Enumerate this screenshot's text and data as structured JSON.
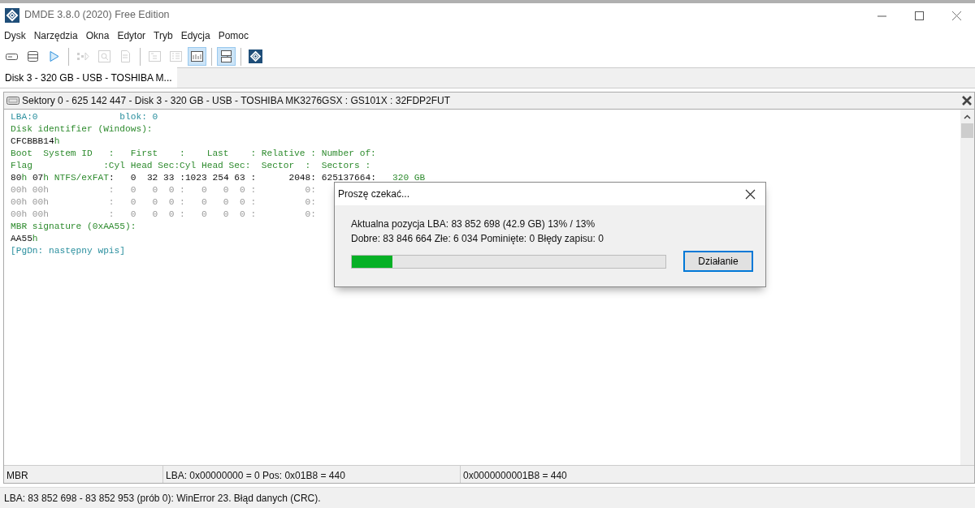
{
  "window": {
    "title": "DMDE 3.8.0 (2020) Free Edition"
  },
  "menu": [
    "Dysk",
    "Narzędzia",
    "Okna",
    "Edytor",
    "Tryb",
    "Edycja",
    "Pomoc"
  ],
  "toolbar": [
    {
      "disabled": false,
      "pressed": false
    },
    {
      "disabled": false,
      "pressed": false
    },
    {
      "disabled": false,
      "pressed": false
    },
    {
      "disabled": true,
      "pressed": false
    },
    {
      "disabled": true,
      "pressed": false
    },
    {
      "disabled": true,
      "pressed": false
    },
    {
      "disabled": true,
      "pressed": false
    },
    {
      "disabled": true,
      "pressed": false
    },
    {
      "disabled": false,
      "pressed": true
    },
    {
      "disabled": false,
      "pressed": true
    },
    {
      "disabled": false,
      "pressed": false
    }
  ],
  "tabs": [
    {
      "label": "Disk 3 - 320 GB - USB - TOSHIBA M...",
      "selected": true
    }
  ],
  "panel": {
    "title": "Sektory 0 - 625 142 447 - Disk 3 - 320 GB - USB - TOSHIBA MK3276GSX : GS101X : 32FDP2FUT",
    "lines": [
      [
        {
          "text": "LBA:0               blok: 0",
          "kind": "link"
        }
      ],
      [
        {
          "text": "Disk identifier (Windows):",
          "kind": "label"
        }
      ],
      [
        {
          "text": "CFCBBB14",
          "kind": "value"
        },
        {
          "text": "h",
          "kind": "label"
        }
      ],
      [
        {
          "text": "Boot  System ID   :   First    :    Last    : Relative : Number of:",
          "kind": "label"
        }
      ],
      [
        {
          "text": "Flag             :Cyl Head Sec:Cyl Head Sec:  Sector  :  Sectors :",
          "kind": "label"
        }
      ],
      [
        {
          "text": "80",
          "kind": "value"
        },
        {
          "text": "h ",
          "kind": "label"
        },
        {
          "text": "07",
          "kind": "value"
        },
        {
          "text": "h NTFS/exFAT",
          "kind": "label"
        },
        {
          "text": ":   0  32 33 :1023 254 63 :      2048: 625137664:",
          "kind": "value"
        },
        {
          "text": "   320 GB",
          "kind": "label"
        }
      ],
      [
        {
          "text": "00h 00h           :   0   0  0 :   0   0  0 :         0:",
          "kind": "zero"
        }
      ],
      [
        {
          "text": "00h 00h           :   0   0  0 :   0   0  0 :         0:",
          "kind": "zero"
        }
      ],
      [
        {
          "text": "00h 00h           :   0   0  0 :   0   0  0 :         0:",
          "kind": "zero"
        }
      ],
      [
        {
          "text": "MBR signature (0xAA55):",
          "kind": "label"
        }
      ],
      [
        {
          "text": "AA55",
          "kind": "value"
        },
        {
          "text": "h",
          "kind": "label"
        }
      ],
      [
        {
          "text": "[PgDn: następny wpis]",
          "kind": "link"
        }
      ]
    ],
    "status": [
      "MBR",
      "LBA: 0x00000000 = 0  Pos: 0x01B8 = 440",
      "0x0000000001B8 = 440"
    ]
  },
  "dialog": {
    "title": "Proszę czekać...",
    "line1": "Aktualna pozycja LBA: 83 852 698 (42.9 GB) 13% / 13%",
    "line2": "Dobre: 83 846 664  Złe: 6 034  Pominięte: 0  Błędy zapisu: 0",
    "progress": {
      "level": 0.13
    },
    "button": "Działanie"
  },
  "status_bar": "LBA: 83 852 698 - 83 852 953 (prób 0): WinError 23. Błąd danych (CRC)."
}
